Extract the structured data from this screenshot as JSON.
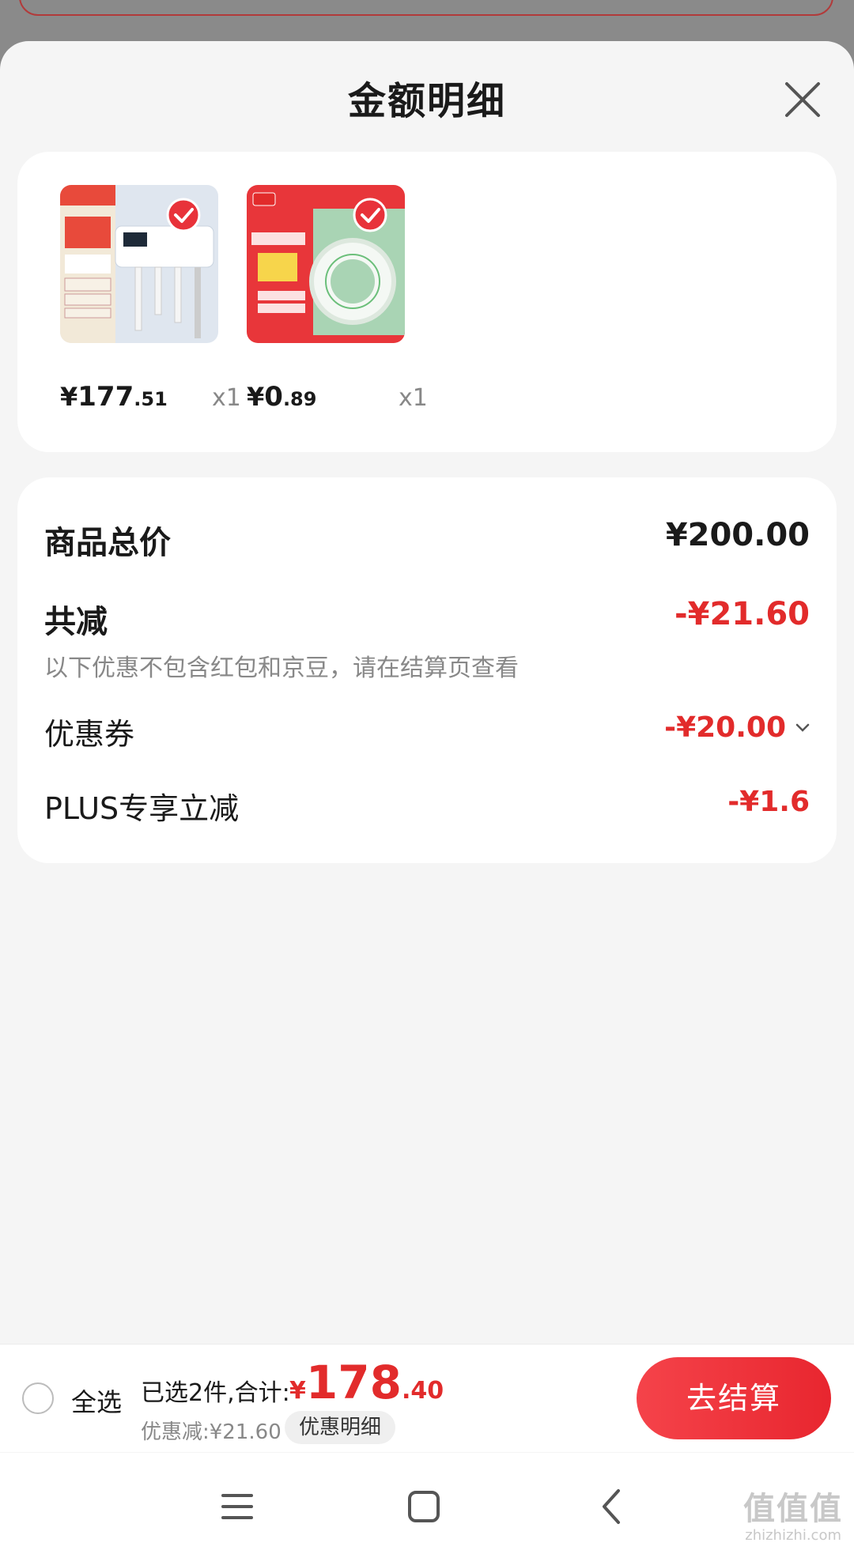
{
  "sheet": {
    "title": "金额明细"
  },
  "products": [
    {
      "name_icon": "toothbrush-holder-image",
      "price_symbol": "¥",
      "price_int": "177",
      "price_dec": ".51",
      "quantity": "x1"
    },
    {
      "name_icon": "tape-roll-image",
      "price_symbol": "¥",
      "price_int": "0",
      "price_dec": ".89",
      "quantity": "x1"
    }
  ],
  "details": {
    "total_label": "商品总价",
    "total_value": "¥200.00",
    "reduce_label": "共减",
    "reduce_value": "-¥21.60",
    "note": "以下优惠不包含红包和京豆，请在结算页查看",
    "coupon_label": "优惠券",
    "coupon_value": "-¥20.00",
    "plus_label": "PLUS专享立减",
    "plus_value": "-¥1.6"
  },
  "bottom": {
    "select_all": "全选",
    "selected_text": "已选2件,合计:",
    "total_symbol": "¥",
    "total_int": "178",
    "total_dec": ".40",
    "discount_text": "优惠减:¥21.60",
    "discount_detail": "优惠明细",
    "checkout": "去结算"
  },
  "watermark": {
    "main": "值值值",
    "sub": "zhizhizhi.com"
  },
  "colors": {
    "accent": "#e22b2b",
    "checkout_start": "#f5434a",
    "checkout_end": "#e8262f"
  }
}
